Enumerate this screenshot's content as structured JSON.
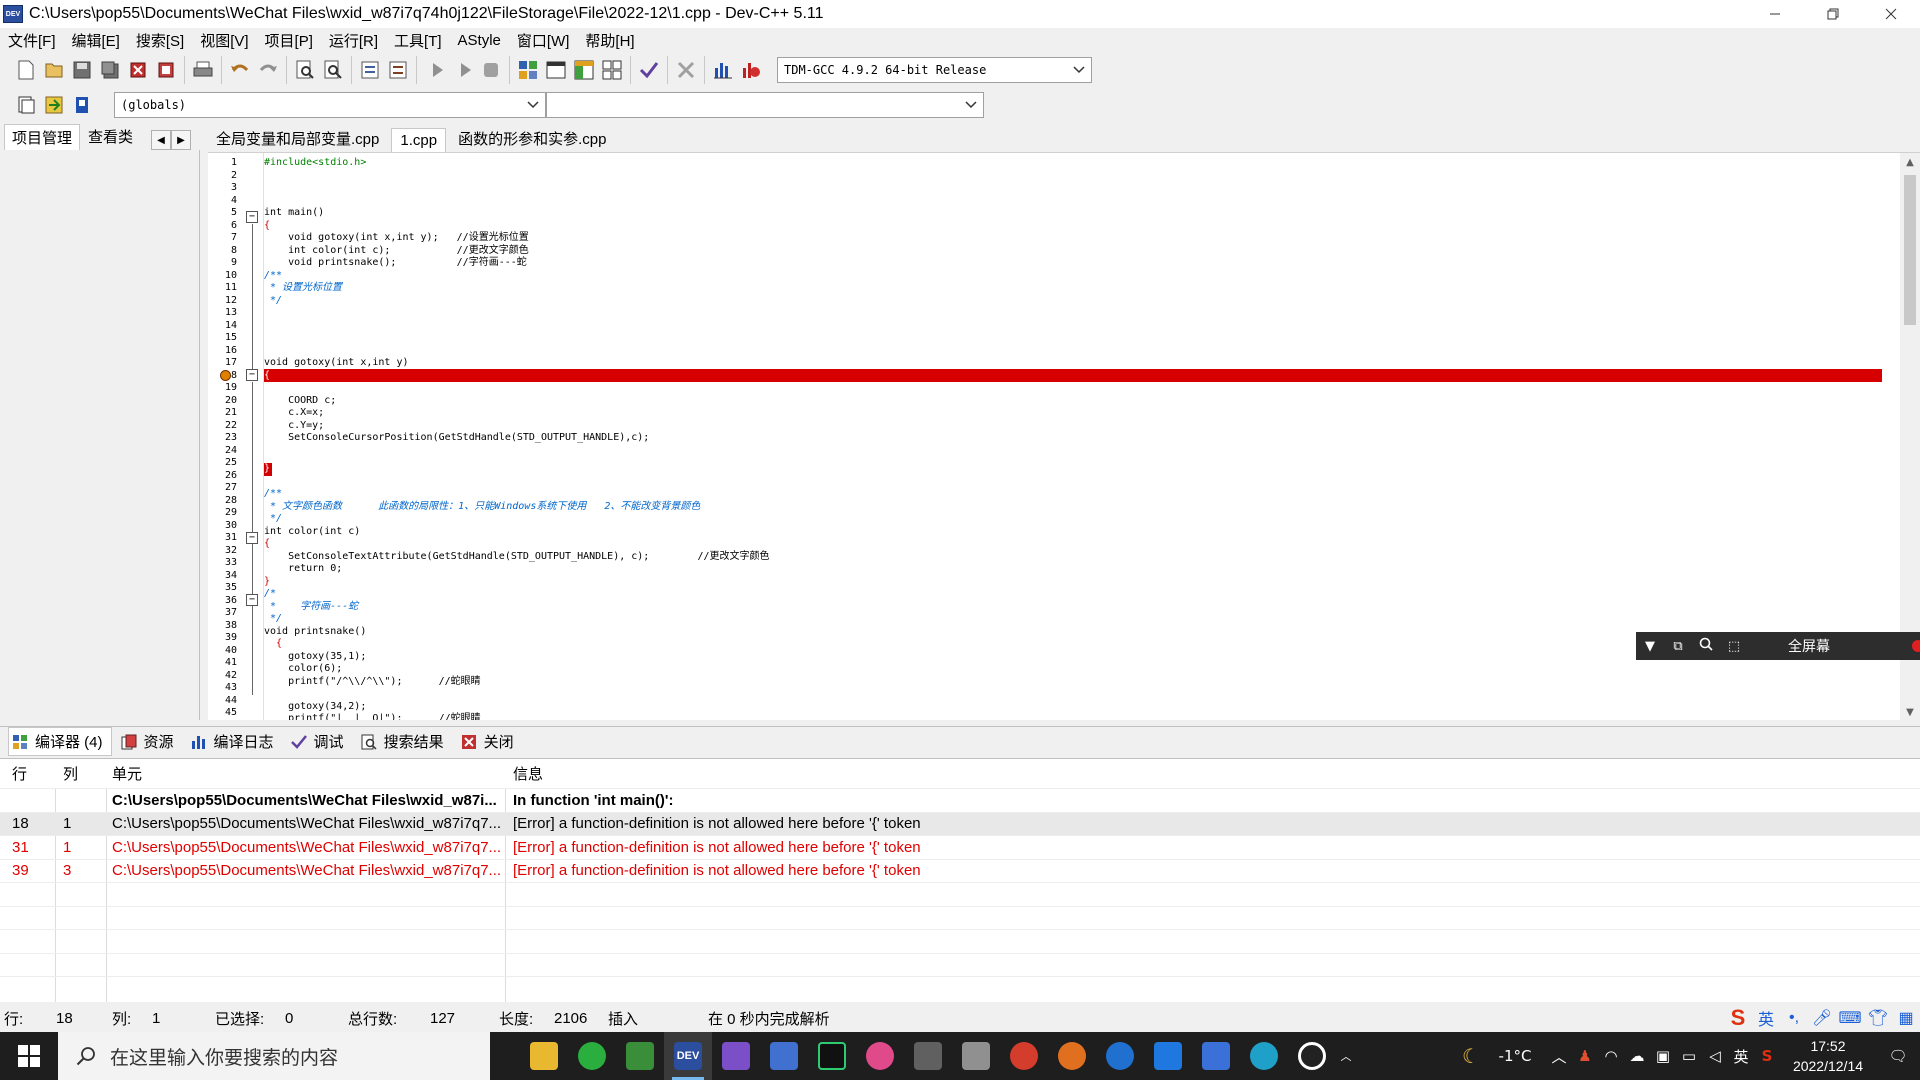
{
  "window": {
    "title": "C:\\Users\\pop55\\Documents\\WeChat Files\\wxid_w87i7q74h0j122\\FileStorage\\File\\2022-12\\1.cpp - Dev-C++ 5.11",
    "app_icon_text": "DEV"
  },
  "menu": [
    "文件[F]",
    "编辑[E]",
    "搜索[S]",
    "视图[V]",
    "项目[P]",
    "运行[R]",
    "工具[T]",
    "AStyle",
    "窗口[W]",
    "帮助[H]"
  ],
  "toolbar": {
    "compiler": "TDM-GCC 4.9.2 64-bit Release",
    "scope": "(globals)",
    "function": ""
  },
  "left_tabs": [
    "项目管理",
    "查看类"
  ],
  "editor_tabs": [
    "全局变量和局部变量.cpp",
    "1.cpp",
    "函数的形参和实参.cpp"
  ],
  "code": {
    "line_numbers": [
      "1",
      "2",
      "3",
      "4",
      "5",
      "6",
      "7",
      "8",
      "9",
      "10",
      "11",
      "12",
      "13",
      "14",
      "15",
      "16",
      "17",
      "18",
      "19",
      "20",
      "21",
      "22",
      "23",
      "24",
      "25",
      "26",
      "27",
      "28",
      "29",
      "30",
      "31",
      "32",
      "33",
      "34",
      "35",
      "36",
      "37",
      "38",
      "39",
      "40",
      "41",
      "42",
      "43",
      "44",
      "45"
    ],
    "lines": [
      {
        "t": "#include<stdio.h>",
        "c": "pre"
      },
      {
        "t": "",
        "c": ""
      },
      {
        "t": "",
        "c": ""
      },
      {
        "t": "",
        "c": ""
      },
      {
        "t": "int main()",
        "c": ""
      },
      {
        "t": "{",
        "c": "red"
      },
      {
        "t": "    void gotoxy(int x,int y);   //设置光标位置",
        "c": ""
      },
      {
        "t": "    int color(int c);           //更改文字颜色",
        "c": ""
      },
      {
        "t": "    void printsnake();          //字符画---蛇",
        "c": ""
      },
      {
        "t": "/**",
        "c": "cmt"
      },
      {
        "t": " * 设置光标位置",
        "c": "cmt"
      },
      {
        "t": " */",
        "c": "cmt"
      },
      {
        "t": "",
        "c": ""
      },
      {
        "t": "",
        "c": ""
      },
      {
        "t": "",
        "c": ""
      },
      {
        "t": "",
        "c": ""
      },
      {
        "t": "void gotoxy(int x,int y)",
        "c": ""
      },
      {
        "t": "{",
        "c": "errline"
      },
      {
        "t": "",
        "c": ""
      },
      {
        "t": "    COORD c;",
        "c": ""
      },
      {
        "t": "    c.X=x;",
        "c": ""
      },
      {
        "t": "    c.Y=y;",
        "c": ""
      },
      {
        "t": "    SetConsoleCursorPosition(GetStdHandle(STD_OUTPUT_HANDLE),c);",
        "c": ""
      },
      {
        "t": "",
        "c": ""
      },
      {
        "t": "}",
        "c": "redbox"
      },
      {
        "t": "",
        "c": ""
      },
      {
        "t": "/**",
        "c": "cmt"
      },
      {
        "t": " * 文字颜色函数      此函数的局限性：1、只能Windows系统下使用   2、不能改变背景颜色",
        "c": "cmt"
      },
      {
        "t": " */",
        "c": "cmt"
      },
      {
        "t": "int color(int c)",
        "c": ""
      },
      {
        "t": "{",
        "c": "red"
      },
      {
        "t": "    SetConsoleTextAttribute(GetStdHandle(STD_OUTPUT_HANDLE), c);        //更改文字颜色",
        "c": ""
      },
      {
        "t": "    return 0;",
        "c": ""
      },
      {
        "t": "}",
        "c": "red"
      },
      {
        "t": "/*",
        "c": "cmt"
      },
      {
        "t": " *    字符画---蛇",
        "c": "cmt"
      },
      {
        "t": " */",
        "c": "cmt"
      },
      {
        "t": "void printsnake()",
        "c": ""
      },
      {
        "t": "  {",
        "c": "red"
      },
      {
        "t": "    gotoxy(35,1);",
        "c": ""
      },
      {
        "t": "    color(6);",
        "c": ""
      },
      {
        "t": "    printf(\"/^\\\\/^\\\\\");      //蛇眼睛",
        "c": ""
      },
      {
        "t": "",
        "c": ""
      },
      {
        "t": "    gotoxy(34,2);",
        "c": ""
      },
      {
        "t": "    printf(\"|__|  O|\");      //蛇眼睛",
        "c": ""
      }
    ]
  },
  "floatbar": {
    "label": "全屏幕"
  },
  "bottom_tabs": [
    "编译器 (4)",
    "资源",
    "编译日志",
    "调试",
    "搜索结果",
    "关闭"
  ],
  "messages": {
    "headers": {
      "line": "行",
      "col": "列",
      "unit": "单元",
      "info": "信息"
    },
    "rows": [
      {
        "line": "",
        "col": "",
        "unit": "C:\\Users\\pop55\\Documents\\WeChat Files\\wxid_w87i...",
        "info": "In function 'int main()':",
        "style": "bold"
      },
      {
        "line": "18",
        "col": "1",
        "unit": "C:\\Users\\pop55\\Documents\\WeChat Files\\wxid_w87i7q7...",
        "info": "[Error] a function-definition is not allowed here before '{' token",
        "style": "hl"
      },
      {
        "line": "31",
        "col": "1",
        "unit": "C:\\Users\\pop55\\Documents\\WeChat Files\\wxid_w87i7q7...",
        "info": "[Error] a function-definition is not allowed here before '{' token",
        "style": "red"
      },
      {
        "line": "39",
        "col": "3",
        "unit": "C:\\Users\\pop55\\Documents\\WeChat Files\\wxid_w87i7q7...",
        "info": "[Error] a function-definition is not allowed here before '{' token",
        "style": "red"
      }
    ]
  },
  "status": {
    "line_label": "行:",
    "line": "18",
    "col_label": "列:",
    "col": "1",
    "sel_label": "已选择:",
    "sel": "0",
    "total_label": "总行数:",
    "total": "127",
    "len_label": "长度:",
    "len": "2106",
    "mode": "插入",
    "parse": "在 0 秒内完成解析"
  },
  "ime": {
    "lang": "英"
  },
  "taskbar": {
    "search_placeholder": "在这里输入你要搜索的内容",
    "weather": "-1°C",
    "tray_lang": "英",
    "time": "17:52",
    "date": "2022/12/14"
  }
}
